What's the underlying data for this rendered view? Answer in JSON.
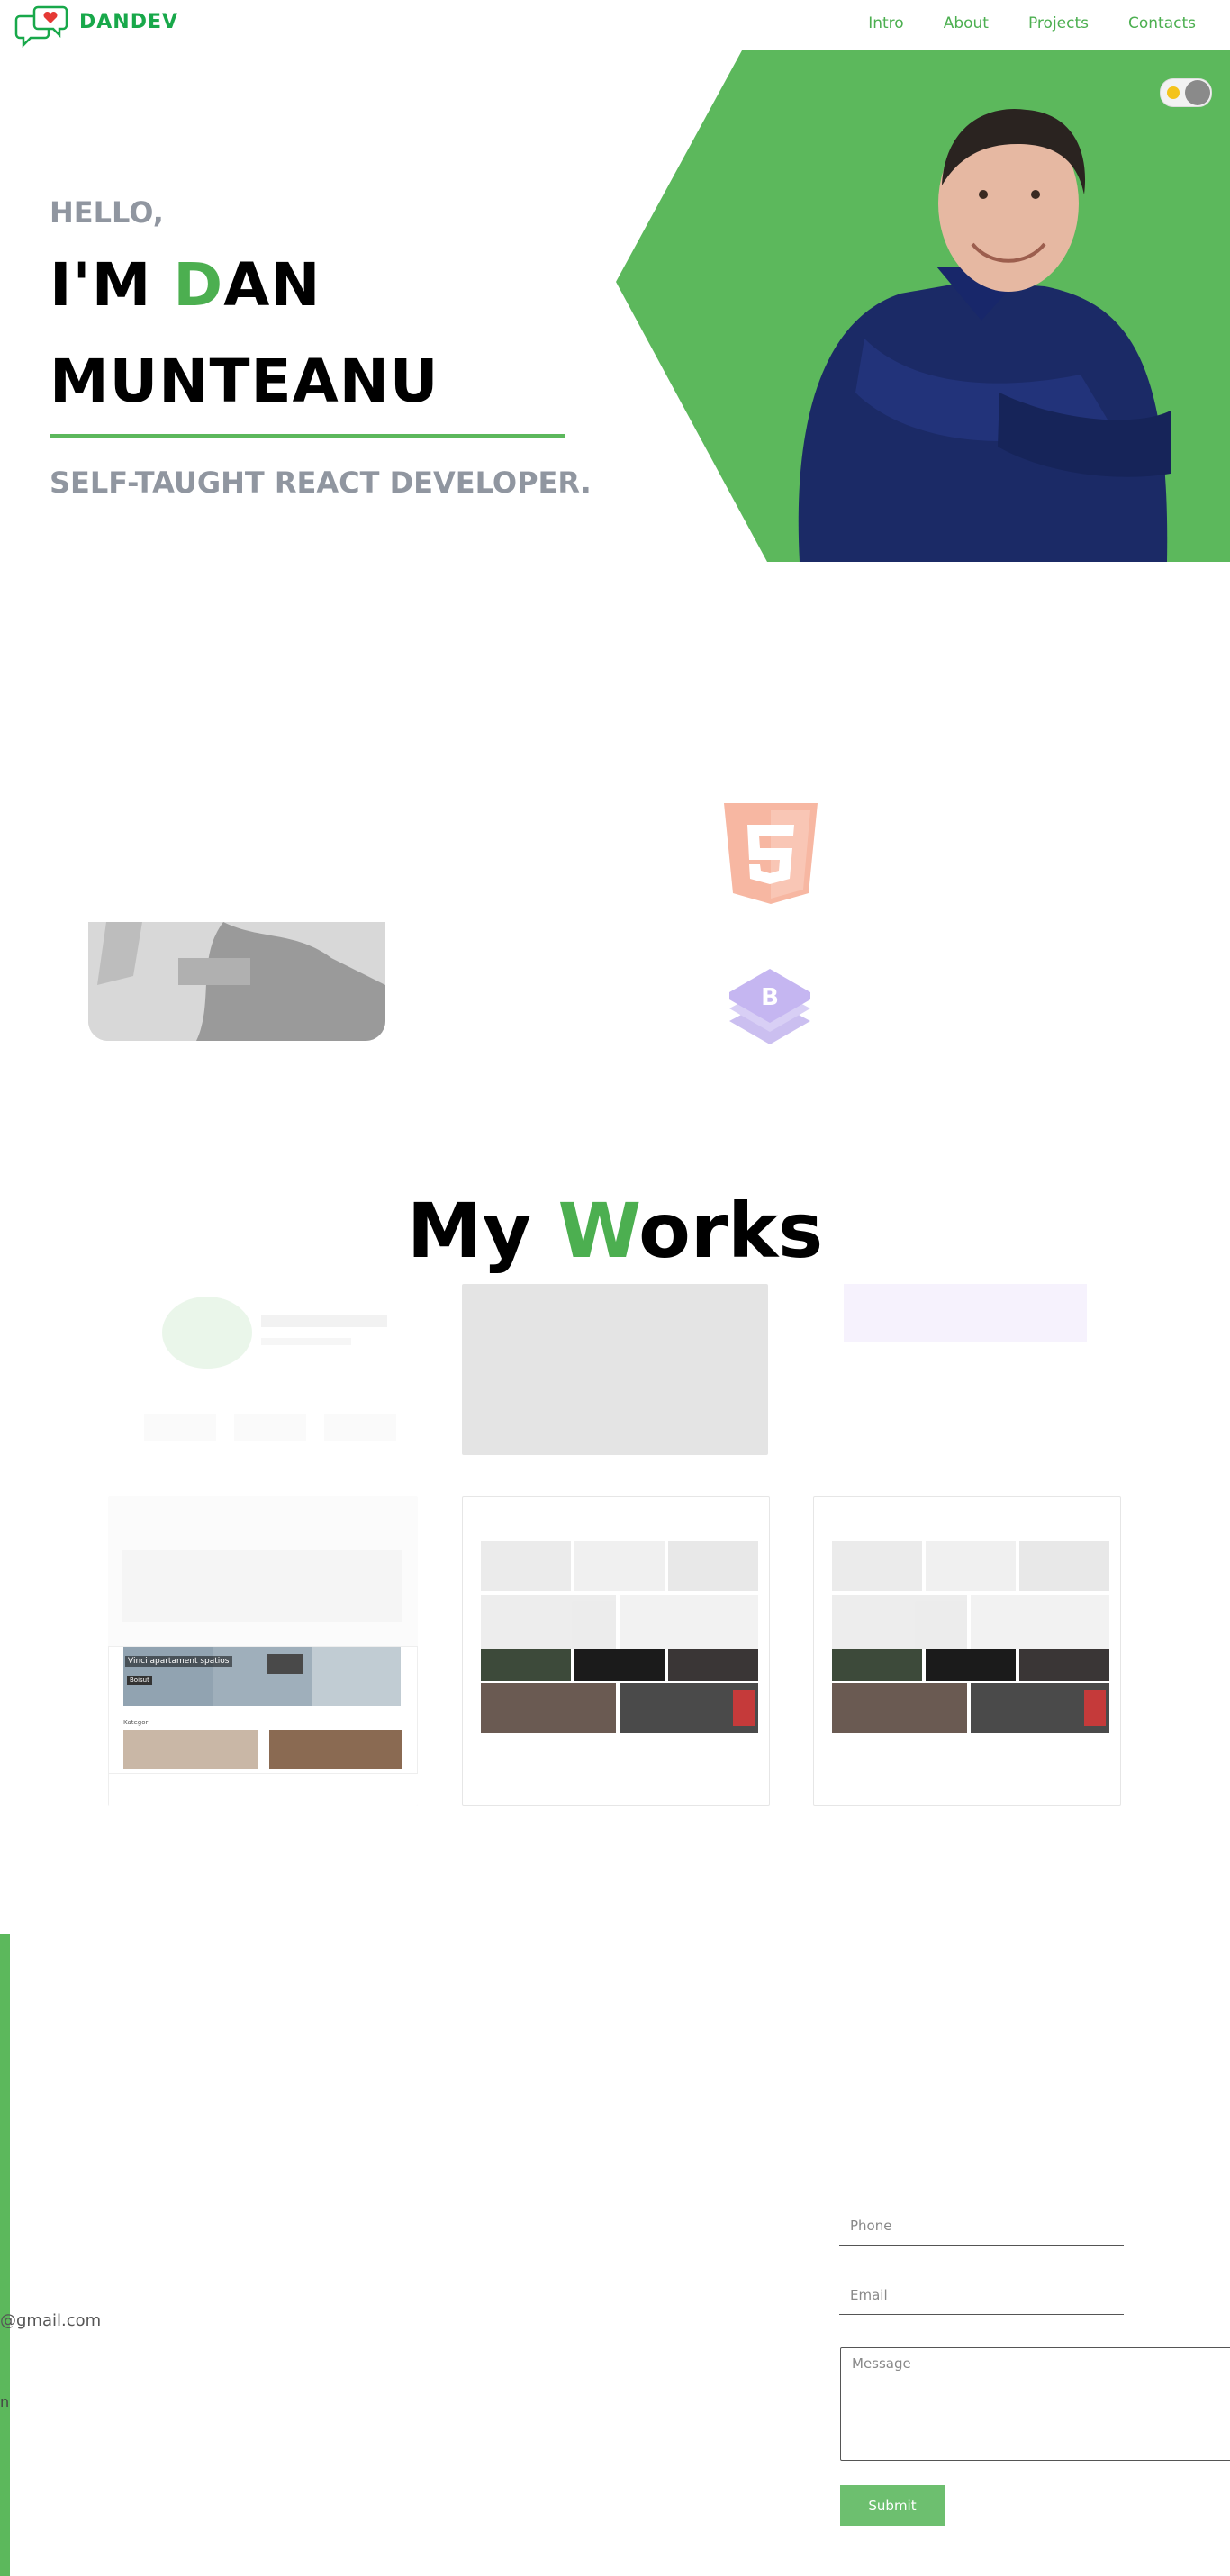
{
  "brand": {
    "name": "DANDEV",
    "accent_color": "#4caf50",
    "green_bg": "#5cb85c"
  },
  "nav": {
    "links": [
      {
        "label": "Intro"
      },
      {
        "label": "About"
      },
      {
        "label": "Projects"
      },
      {
        "label": "Contacts"
      }
    ]
  },
  "theme_toggle": {
    "icons": [
      "sun-icon",
      "moon-knob"
    ]
  },
  "hero": {
    "hello": "HELLO,",
    "name_prefix": "I'M ",
    "name_initial": "D",
    "name_rest": "AN",
    "surname": "MUNTEANU",
    "tagline": "SELF-TAUGHT REACT DEVELOPER."
  },
  "skills": {
    "icons": [
      "html5-icon",
      "bootstrap-icon"
    ]
  },
  "works": {
    "title_prefix": "My ",
    "title_initial": "W",
    "title_rest": "orks",
    "cards": [
      {
        "text": ""
      },
      {
        "text": ""
      },
      {
        "text": ""
      },
      {
        "text": "Vinci apartament spatios",
        "badge": "Boisut",
        "section": "Kategor"
      },
      {
        "text": ""
      },
      {
        "text": ""
      }
    ]
  },
  "contact": {
    "email_fragment": "@gmail.com",
    "phone_placeholder": "Phone",
    "email_placeholder": "Email",
    "message_placeholder": "Message",
    "submit_label": "Submit"
  }
}
